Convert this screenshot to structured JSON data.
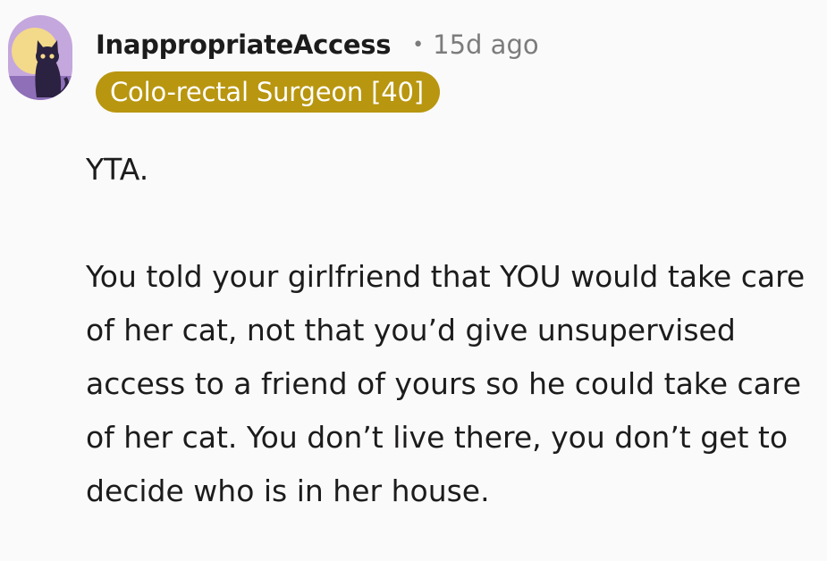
{
  "comment": {
    "username": "InappropriateAccess",
    "separator": "•",
    "timestamp": "15d ago",
    "flair": "Colo-rectal Surgeon [40]",
    "paragraphs": [
      "YTA.",
      "You told your girlfriend that YOU would take care of her cat, not that you’d give unsupervised access to a friend of yours so he could take care of her cat. You don’t live there, you don’t get to decide who is in her house."
    ]
  },
  "colors": {
    "flair_background": "#b8960f",
    "flair_text": "#ffffff",
    "timestamp": "#7c7c7c",
    "avatar_background": "#c4a7dd"
  }
}
